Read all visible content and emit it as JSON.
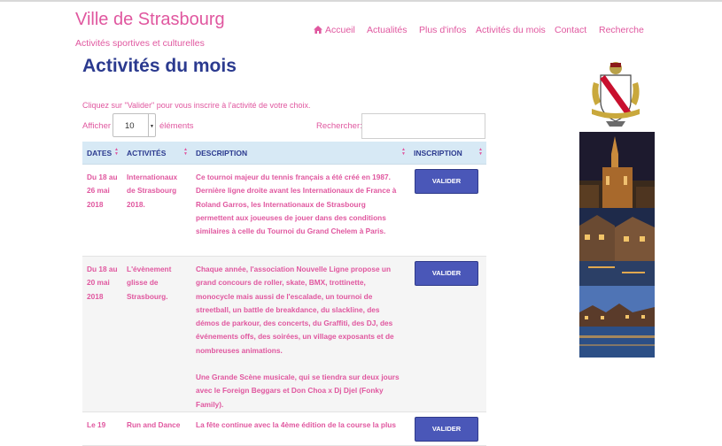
{
  "site": {
    "title": "Ville de Strasbourg",
    "subtitle": "Activités sportives et culturelles"
  },
  "nav": [
    {
      "label": "Accueil",
      "icon": "home-icon"
    },
    {
      "label": "Actualités"
    },
    {
      "label": "Plus d'infos"
    },
    {
      "label": "Activités du mois"
    },
    {
      "label": "Contact"
    },
    {
      "label": "Recherche"
    }
  ],
  "page": {
    "title": "Activités du mois",
    "instruction": "Cliquez sur \"Valider\" pour vous inscrire à l'activité de votre choix."
  },
  "table_controls": {
    "show_label": "Afficher",
    "show_value": "10",
    "show_after": "éléments",
    "search_label": "Rechercher:",
    "search_value": ""
  },
  "table": {
    "headers": [
      "DATES",
      "ACTIVITÉS",
      "DESCRIPTION",
      "INSCRIPTION"
    ],
    "button_label": "VALIDER",
    "rows": [
      {
        "dates": "Du 18 au 26 mai 2018",
        "activity": "Internationaux de Strasbourg 2018.",
        "description": "Ce tournoi majeur du tennis français a été créé en 1987. Dernière ligne droite avant les Internationaux de France à Roland Garros, les Internationaux de Strasbourg permettent aux joueuses de jouer dans des conditions similaires à celle du Tournoi du Grand Chelem à Paris."
      },
      {
        "dates": "Du 18 au 20 mai 2018",
        "activity": "L'évènement glisse de Strasbourg.",
        "description": "Chaque année, l'association Nouvelle Ligne propose un grand concours de roller, skate, BMX, trottinette, monocycle mais aussi de l'escalade, un tournoi de streetball, un battle de breakdance, du slackline, des démos de parkour, des concerts, du Graffiti, des DJ, des événements offs, des soirées, un village exposants et de nombreuses animations.",
        "description2": "Une Grande Scène musicale, qui se tiendra sur deux jours avec le Foreign Beggars et Don Choa x Dj Djel (Fonky Family)."
      },
      {
        "dates": "Le 19",
        "activity": "Run and Dance",
        "description": "La fête continue avec la 4ème édition de la course la plus"
      }
    ]
  },
  "colors": {
    "accent": "#e0579f",
    "title": "#2b3a8f",
    "header_bg": "#d7e9f5",
    "button": "#4a57b8"
  },
  "images": [
    "coat-of-arms",
    "cathedral-night-photo",
    "petite-france-photo",
    "river-night-photo"
  ]
}
